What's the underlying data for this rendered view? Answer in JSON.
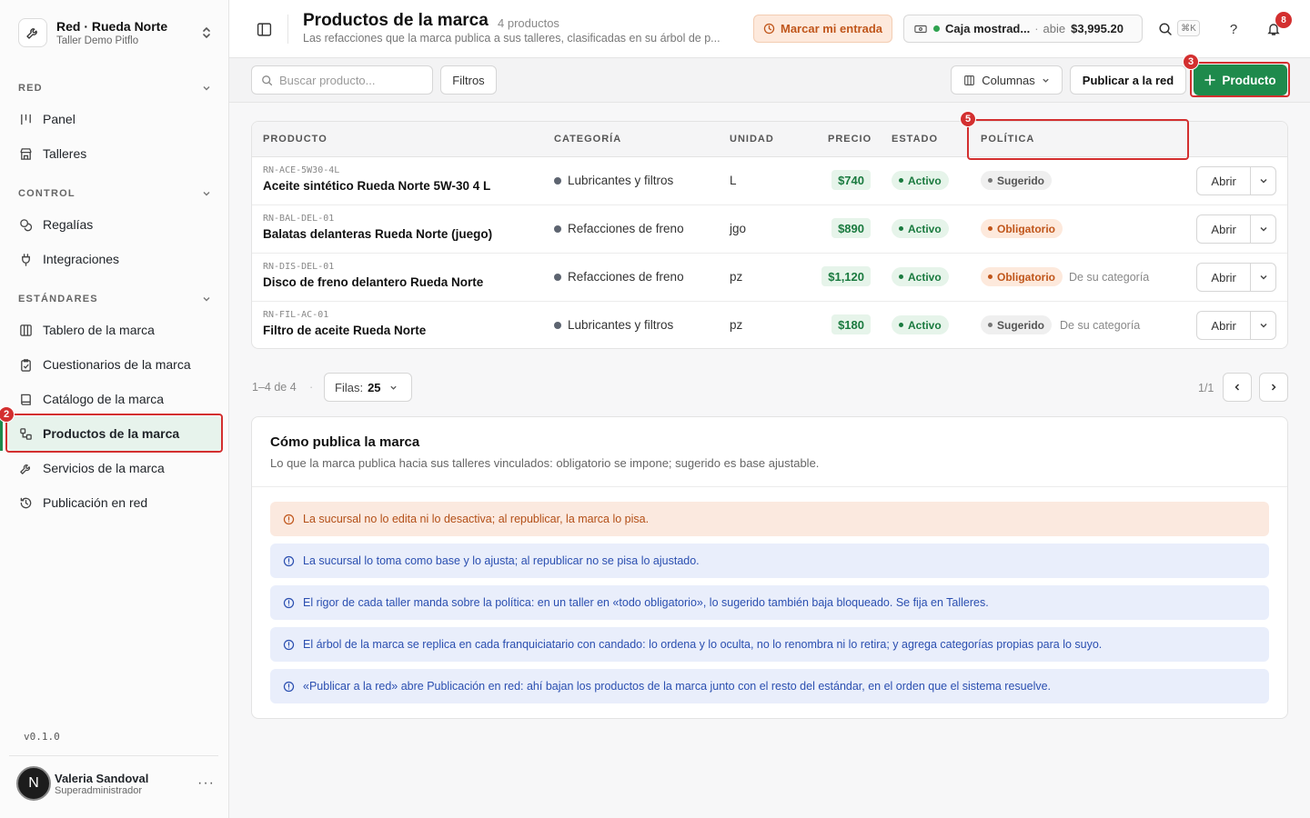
{
  "org": {
    "name": "Red · Rueda Norte",
    "subtitle": "Taller Demo Pitflo"
  },
  "sidebar": {
    "sections": [
      {
        "label": "RED",
        "items": [
          {
            "label": "Panel",
            "icon": "kanban-icon"
          },
          {
            "label": "Talleres",
            "icon": "store-icon"
          }
        ]
      },
      {
        "label": "CONTROL",
        "items": [
          {
            "label": "Regalías",
            "icon": "coins-icon"
          },
          {
            "label": "Integraciones",
            "icon": "plug-icon"
          }
        ]
      },
      {
        "label": "ESTÁNDARES",
        "items": [
          {
            "label": "Tablero de la marca",
            "icon": "columns-icon"
          },
          {
            "label": "Cuestionarios de la marca",
            "icon": "clipboard-check-icon"
          },
          {
            "label": "Catálogo de la marca",
            "icon": "book-icon"
          },
          {
            "label": "Productos de la marca",
            "icon": "product-tree-icon",
            "active": true
          },
          {
            "label": "Servicios de la marca",
            "icon": "wrench-icon"
          },
          {
            "label": "Publicación en red",
            "icon": "history-icon"
          }
        ]
      }
    ],
    "version": "v0.1.0",
    "user": {
      "initial": "N",
      "name": "Valeria Sandoval",
      "role": "Superadministrador"
    }
  },
  "header": {
    "title": "Productos de la marca",
    "count": "4 productos",
    "description": "Las refacciones que la marca publica a sus talleres, clasificadas en su árbol de p...",
    "checkin_label": "Marcar mi entrada",
    "cash": {
      "name": "Caja mostrad...",
      "separator": "·",
      "status": "abie",
      "amount": "$3,995.20"
    },
    "shortcut": "⌘K",
    "notifications": "8"
  },
  "toolbar": {
    "search_placeholder": "Buscar producto...",
    "filters_label": "Filtros",
    "columns_label": "Columnas",
    "publish_label": "Publicar a la red",
    "add_label": "Producto"
  },
  "annotations": {
    "step_nav": "2",
    "step_add": "3",
    "step_policy": "5"
  },
  "table": {
    "headers": {
      "product": "PRODUCTO",
      "category": "CATEGORÍA",
      "unit": "UNIDAD",
      "price": "PRECIO",
      "status": "ESTADO",
      "policy": "POLÍTICA"
    },
    "open_label": "Abrir",
    "rows": [
      {
        "sku": "RN-ACE-5W30-4L",
        "name": "Aceite sintético Rueda Norte 5W-30 4 L",
        "category": "Lubricantes y filtros",
        "unit": "L",
        "price": "$740",
        "status": "Activo",
        "policy": "Sugerido",
        "policy_type": "sug",
        "inherited": ""
      },
      {
        "sku": "RN-BAL-DEL-01",
        "name": "Balatas delanteras Rueda Norte (juego)",
        "category": "Refacciones de freno",
        "unit": "jgo",
        "price": "$890",
        "status": "Activo",
        "policy": "Obligatorio",
        "policy_type": "obl",
        "inherited": ""
      },
      {
        "sku": "RN-DIS-DEL-01",
        "name": "Disco de freno delantero Rueda Norte",
        "category": "Refacciones de freno",
        "unit": "pz",
        "price": "$1,120",
        "status": "Activo",
        "policy": "Obligatorio",
        "policy_type": "obl",
        "inherited": "De su categoría"
      },
      {
        "sku": "RN-FIL-AC-01",
        "name": "Filtro de aceite Rueda Norte",
        "category": "Lubricantes y filtros",
        "unit": "pz",
        "price": "$180",
        "status": "Activo",
        "policy": "Sugerido",
        "policy_type": "sug",
        "inherited": "De su categoría"
      }
    ]
  },
  "pagination": {
    "range": "1–4 de 4",
    "dot": "·",
    "rows_label": "Filas:",
    "rows_value": "25",
    "page": "1/1"
  },
  "info": {
    "title": "Cómo publica la marca",
    "subtitle": "Lo que la marca publica hacia sus talleres vinculados: obligatorio se impone; sugerido es base ajustable.",
    "notices": [
      {
        "type": "warn",
        "text": "La sucursal no lo edita ni lo desactiva; al republicar, la marca lo pisa."
      },
      {
        "type": "info",
        "text": "La sucursal lo toma como base y lo ajusta; al republicar no se pisa lo ajustado."
      },
      {
        "type": "info",
        "text": "El rigor de cada taller manda sobre la política: en un taller en «todo obligatorio», lo sugerido también baja bloqueado. Se fija en Talleres."
      },
      {
        "type": "info",
        "text": "El árbol de la marca se replica en cada franquiciatario con candado: lo ordena y lo oculta, no lo renombra ni lo retira; y agrega categorías propias para lo suyo."
      },
      {
        "type": "info",
        "text": "«Publicar a la red» abre Publicación en red: ahí bajan los productos de la marca junto con el resto del estándar, en el orden que el sistema resuelve."
      }
    ]
  },
  "colors": {
    "brand": "#1e8a4c",
    "annotation": "#d32f2f",
    "warning": "#c0561b",
    "info": "#2b4fb0"
  }
}
